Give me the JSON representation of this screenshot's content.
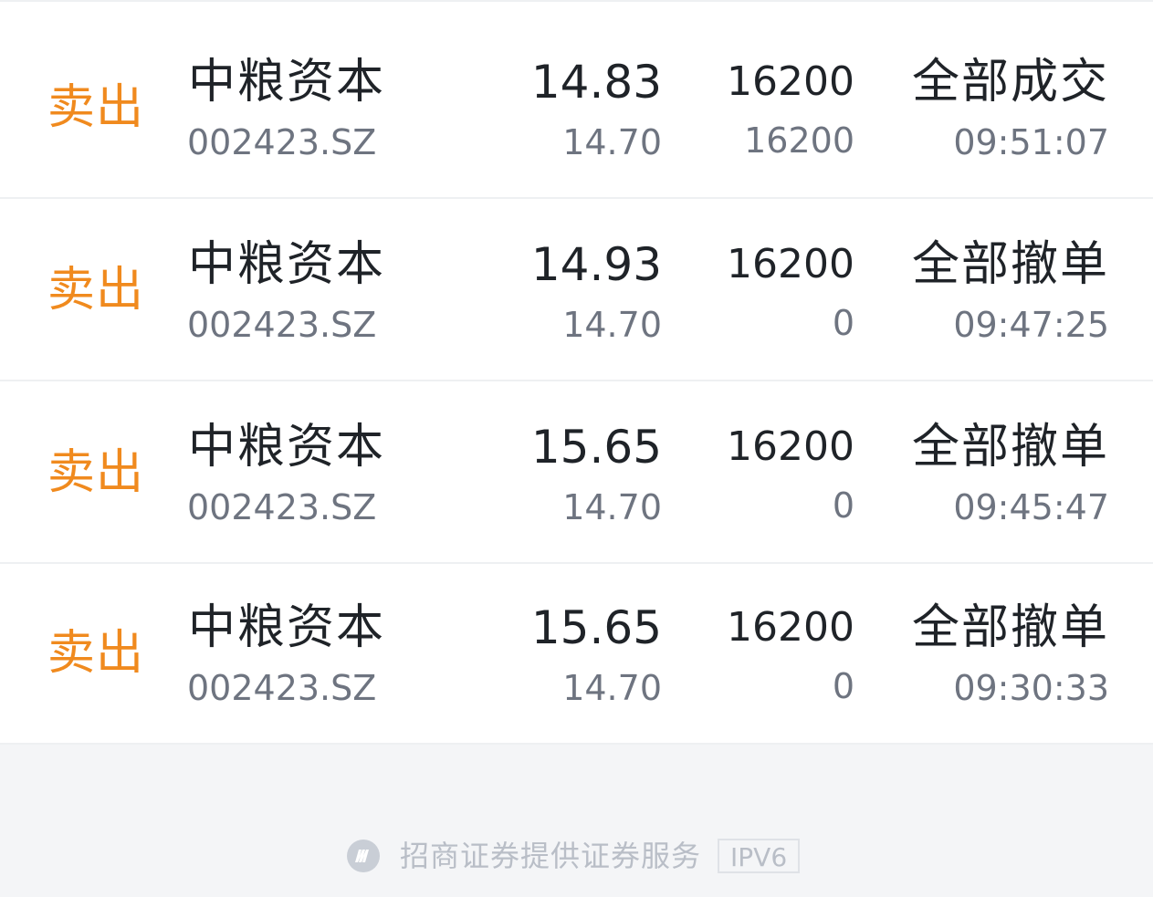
{
  "orders": [
    {
      "side": "卖出",
      "name": "中粮资本",
      "code": "002423.SZ",
      "price": "14.83",
      "price_sub": "14.70",
      "qty": "16200",
      "qty_sub": "16200",
      "status": "全部成交",
      "time": "09:51:07"
    },
    {
      "side": "卖出",
      "name": "中粮资本",
      "code": "002423.SZ",
      "price": "14.93",
      "price_sub": "14.70",
      "qty": "16200",
      "qty_sub": "0",
      "status": "全部撤单",
      "time": "09:47:25"
    },
    {
      "side": "卖出",
      "name": "中粮资本",
      "code": "002423.SZ",
      "price": "15.65",
      "price_sub": "14.70",
      "qty": "16200",
      "qty_sub": "0",
      "status": "全部撤单",
      "time": "09:45:47"
    },
    {
      "side": "卖出",
      "name": "中粮资本",
      "code": "002423.SZ",
      "price": "15.65",
      "price_sub": "14.70",
      "qty": "16200",
      "qty_sub": "0",
      "status": "全部撤单",
      "time": "09:30:33"
    }
  ],
  "footer": {
    "provider_text": "招商证券提供证券服务",
    "network_badge": "IPV6",
    "logo_icon": "broker-logo-icon"
  },
  "colors": {
    "sell": "#f08a1e",
    "primary_text": "#1f2328",
    "secondary_text": "#6e7480",
    "footer_text": "#b9bec7",
    "background": "#f4f5f7"
  }
}
